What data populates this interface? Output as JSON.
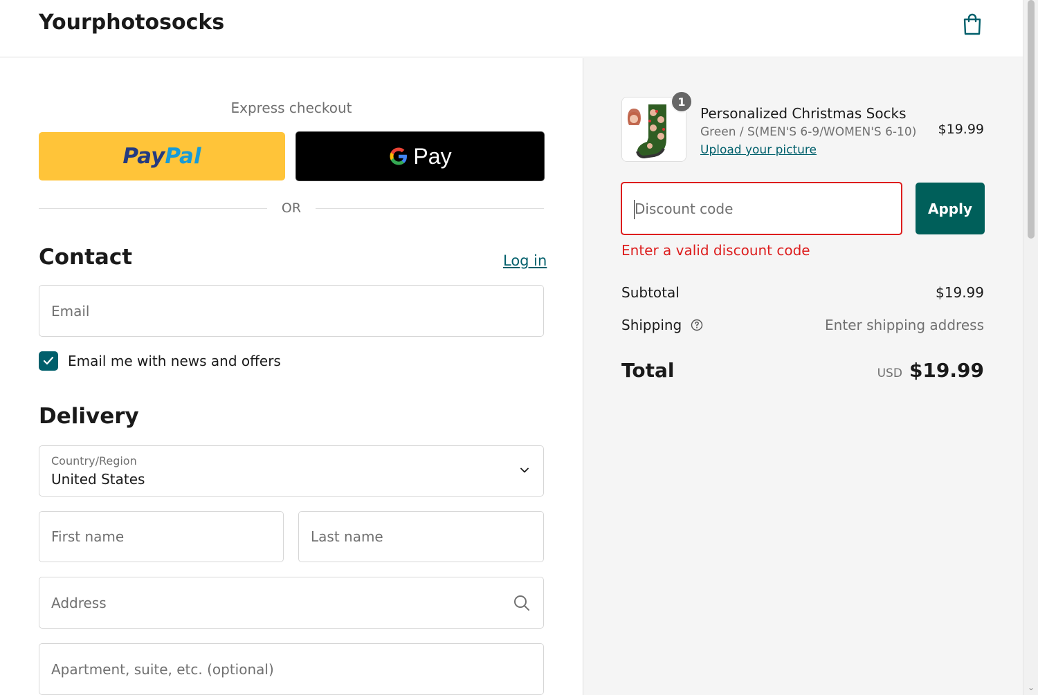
{
  "header": {
    "brand": "Yourphotosocks",
    "cart_icon": "shopping-bag-icon",
    "accent_color": "#005f6b"
  },
  "express_checkout": {
    "label": "Express checkout",
    "paypal_label_part1": "Pay",
    "paypal_label_part2": "Pal",
    "gpay_label": "Pay",
    "divider_text": "OR"
  },
  "contact": {
    "title": "Contact",
    "login_link": "Log in",
    "email_placeholder": "Email",
    "newsletter_label": "Email me with news and offers",
    "newsletter_checked": true
  },
  "delivery": {
    "title": "Delivery",
    "country_label": "Country/Region",
    "country_value": "United States",
    "first_name_placeholder": "First name",
    "last_name_placeholder": "Last name",
    "address_placeholder": "Address",
    "apartment_placeholder": "Apartment, suite, etc. (optional)"
  },
  "order_summary": {
    "item": {
      "quantity": "1",
      "name": "Personalized Christmas Socks",
      "variant": "Green / S(MEN'S 6-9/WOMEN'S 6-10)",
      "upload_link": "Upload your picture",
      "price": "$19.99"
    },
    "discount": {
      "placeholder": "Discount code",
      "apply_label": "Apply",
      "error": "Enter a valid discount code",
      "error_color": "#dd1d1d"
    },
    "subtotal_label": "Subtotal",
    "subtotal_value": "$19.99",
    "shipping_label": "Shipping",
    "shipping_value": "Enter shipping address",
    "total_label": "Total",
    "total_currency": "USD",
    "total_value": "$19.99"
  }
}
